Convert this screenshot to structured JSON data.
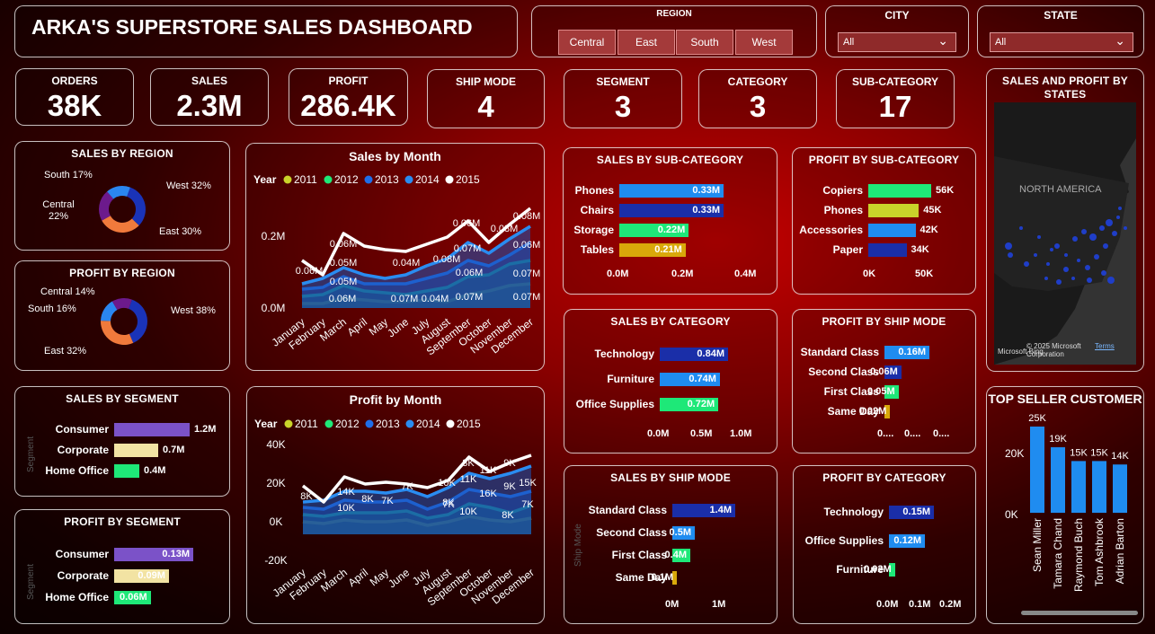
{
  "title": "ARKA'S SUPERSTORE SALES DASHBOARD",
  "region_slicer": {
    "label": "REGION",
    "options": [
      "Central",
      "East",
      "South",
      "West"
    ]
  },
  "city_slicer": {
    "label": "CITY",
    "value": "All"
  },
  "state_slicer": {
    "label": "STATE",
    "value": "All"
  },
  "kpis": {
    "orders": {
      "label": "ORDERS",
      "value": "38K"
    },
    "sales": {
      "label": "SALES",
      "value": "2.3M"
    },
    "profit": {
      "label": "PROFIT",
      "value": "286.4K"
    },
    "ship_mode": {
      "label": "SHIP MODE",
      "value": "4"
    },
    "segment": {
      "label": "SEGMENT",
      "value": "3"
    },
    "category": {
      "label": "CATEGORY",
      "value": "3"
    },
    "sub_category": {
      "label": "SUB-CATEGORY",
      "value": "17"
    }
  },
  "sales_by_region": {
    "title": "SALES BY REGION",
    "labels": [
      "West 32%",
      "East 30%",
      "Central\n22%",
      "South 17%"
    ],
    "values": [
      32,
      30,
      22,
      17
    ],
    "colors": [
      "#1a33b8",
      "#f07a3c",
      "#6c1a8c",
      "#2a86f0"
    ]
  },
  "profit_by_region": {
    "title": "PROFIT BY REGION",
    "labels": [
      "West 38%",
      "East 32%",
      "South 16%",
      "Central 14%"
    ],
    "values": [
      38,
      32,
      16,
      14
    ],
    "colors": [
      "#1a33b8",
      "#f07a3c",
      "#2a86f0",
      "#6c1a8c"
    ]
  },
  "sales_by_month": {
    "title": "Sales by Month",
    "legend_title": "Year",
    "years": [
      "2011",
      "2012",
      "2013",
      "2014",
      "2015"
    ],
    "year_colors": [
      "#c9d32a",
      "#1ee878",
      "#1f6ee8",
      "#2a8cf0",
      "#ffffff"
    ],
    "months": [
      "January",
      "February",
      "March",
      "April",
      "May",
      "June",
      "July",
      "August",
      "September",
      "October",
      "November",
      "December"
    ],
    "y_ticks": [
      "0.2M",
      "0.0M"
    ],
    "point_labels": [
      "0.06M",
      "0.06M",
      "0.05M",
      "0.05M",
      "0.04M",
      "0.07M",
      "0.08M",
      "0.06M",
      "0.07M",
      "0.08M",
      "0.08M",
      "0.06M",
      "0.06M",
      "0.07M",
      "0.04M",
      "0.06M",
      "0.07M",
      "0.07M"
    ]
  },
  "profit_by_month": {
    "title": "Profit by Month",
    "legend_title": "Year",
    "years": [
      "2011",
      "2012",
      "2013",
      "2014",
      "2015"
    ],
    "year_colors": [
      "#c9d32a",
      "#1ee878",
      "#1f6ee8",
      "#2a8cf0",
      "#ffffff"
    ],
    "months": [
      "January",
      "February",
      "March",
      "April",
      "May",
      "June",
      "July",
      "August",
      "September",
      "October",
      "November",
      "December"
    ],
    "y_ticks": [
      "40K",
      "20K",
      "0K",
      "-20K"
    ],
    "point_labels": [
      "8K",
      "14K",
      "10K",
      "8K",
      "7K",
      "7K",
      "10K",
      "8K",
      "11K",
      "8K",
      "11K",
      "9K",
      "16K",
      "9K",
      "15K",
      "7K",
      "10K",
      "8K",
      "7K"
    ]
  },
  "sales_by_subcategory": {
    "title": "SALES BY SUB-CATEGORY",
    "items": [
      {
        "label": "Phones",
        "value": "0.33M",
        "amount": 0.33,
        "color": "#1f8cf0"
      },
      {
        "label": "Chairs",
        "value": "0.33M",
        "amount": 0.33,
        "color": "#1a2ea8"
      },
      {
        "label": "Storage",
        "value": "0.22M",
        "amount": 0.22,
        "color": "#1ee878"
      },
      {
        "label": "Tables",
        "value": "0.21M",
        "amount": 0.21,
        "color": "#d9a80a"
      }
    ],
    "axis": [
      "0.0M",
      "0.2M",
      "0.4M"
    ]
  },
  "profit_by_subcategory": {
    "title": "PROFIT BY SUB-CATEGORY",
    "items": [
      {
        "label": "Copiers",
        "value": "56K",
        "amount": 56,
        "color": "#1ee878"
      },
      {
        "label": "Phones",
        "value": "45K",
        "amount": 45,
        "color": "#c9d32a"
      },
      {
        "label": "Accessories",
        "value": "42K",
        "amount": 42,
        "color": "#1f8cf0"
      },
      {
        "label": "Paper",
        "value": "34K",
        "amount": 34,
        "color": "#1a2ea8"
      }
    ],
    "axis": [
      "0K",
      "50K"
    ]
  },
  "sales_profit_states": {
    "title": "SALES AND PROFIT BY STATES",
    "map_label": "NORTH AMERICA",
    "copyright": "© 2025 Microsoft Corporation",
    "terms": "Terms",
    "brand": "Microsoft Bing"
  },
  "sales_by_segment": {
    "title": "SALES BY SEGMENT",
    "axis_title": "Segment",
    "items": [
      {
        "label": "Consumer",
        "value": "1.2M",
        "amount": 1.2,
        "color": "#7b52c8"
      },
      {
        "label": "Corporate",
        "value": "0.7M",
        "amount": 0.7,
        "color": "#f2e3a3"
      },
      {
        "label": "Home Office",
        "value": "0.4M",
        "amount": 0.4,
        "color": "#1ee878"
      }
    ]
  },
  "profit_by_segment": {
    "title": "PROFIT BY SEGMENT",
    "axis_title": "Segment",
    "items": [
      {
        "label": "Consumer",
        "value": "0.13M",
        "amount": 0.13,
        "color": "#7b52c8"
      },
      {
        "label": "Corporate",
        "value": "0.09M",
        "amount": 0.09,
        "color": "#f2e3a3"
      },
      {
        "label": "Home Office",
        "value": "0.06M",
        "amount": 0.06,
        "color": "#1ee878"
      }
    ]
  },
  "sales_by_category": {
    "title": "SALES BY CATEGORY",
    "items": [
      {
        "label": "Technology",
        "value": "0.84M",
        "amount": 0.84,
        "color": "#1a2ea8"
      },
      {
        "label": "Furniture",
        "value": "0.74M",
        "amount": 0.74,
        "color": "#1f8cf0"
      },
      {
        "label": "Office Supplies",
        "value": "0.72M",
        "amount": 0.72,
        "color": "#1ee878"
      }
    ],
    "axis": [
      "0.0M",
      "0.5M",
      "1.0M"
    ]
  },
  "profit_by_ship_mode": {
    "title": "PROFIT BY SHIP MODE",
    "items": [
      {
        "label": "Standard Class",
        "value": "0.16M",
        "amount": 0.16,
        "color": "#1f8cf0"
      },
      {
        "label": "Second Class",
        "value": "0.06M",
        "amount": 0.06,
        "color": "#1a2ea8"
      },
      {
        "label": "First Class",
        "value": "0.05M",
        "amount": 0.05,
        "color": "#1ee878"
      },
      {
        "label": "Same Day",
        "value": "0.02M",
        "amount": 0.02,
        "color": "#d9a80a"
      }
    ],
    "axis": [
      "0....",
      "0....",
      "0...."
    ]
  },
  "sales_by_ship_mode": {
    "title": "SALES BY SHIP MODE",
    "axis_title": "Ship Mode",
    "items": [
      {
        "label": "Standard Class",
        "value": "1.4M",
        "amount": 1.4,
        "color": "#1a2ea8"
      },
      {
        "label": "Second Class",
        "value": "0.5M",
        "amount": 0.5,
        "color": "#1f8cf0"
      },
      {
        "label": "First Class",
        "value": "0.4M",
        "amount": 0.4,
        "color": "#1ee878"
      },
      {
        "label": "Same Day",
        "value": "0.1M",
        "amount": 0.1,
        "color": "#d9a80a"
      }
    ],
    "axis": [
      "0M",
      "1M"
    ]
  },
  "profit_by_category": {
    "title": "PROFIT BY CATEGORY",
    "items": [
      {
        "label": "Technology",
        "value": "0.15M",
        "amount": 0.15,
        "color": "#1a2ea8"
      },
      {
        "label": "Office Supplies",
        "value": "0.12M",
        "amount": 0.12,
        "color": "#1f8cf0"
      },
      {
        "label": "Furniture",
        "value": "0.02M",
        "amount": 0.02,
        "color": "#1ee878"
      }
    ],
    "axis": [
      "0.0M",
      "0.1M",
      "0.2M"
    ]
  },
  "top_seller": {
    "title": "TOP SELLER CUSTOMER",
    "y_ticks": [
      "20K",
      "0K"
    ],
    "customers": [
      "Sean Miller",
      "Tamara Chand",
      "Raymond Buch",
      "Tom Ashbrook",
      "Adrian Barton"
    ],
    "values": [
      25,
      19,
      15,
      15,
      14
    ],
    "value_labels": [
      "25K",
      "19K",
      "15K",
      "15K",
      "14K"
    ],
    "color": "#1f8cf0"
  }
}
